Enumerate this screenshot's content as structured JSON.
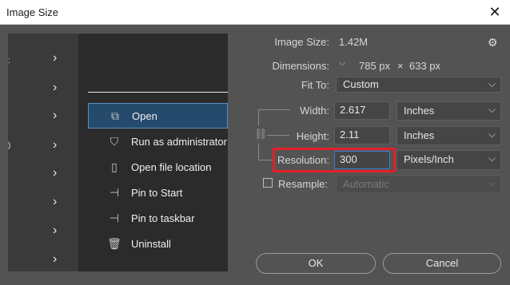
{
  "window": {
    "title": "Image Size"
  },
  "preview": {
    "menu_items": [
      {
        "label": "Open",
        "icon": "open-icon",
        "glyph": "⧉"
      },
      {
        "label": "Run as administrator",
        "icon": "shield-icon",
        "glyph": "⛉"
      },
      {
        "label": "Open file location",
        "icon": "file-location-icon",
        "glyph": "▯"
      },
      {
        "label": "Pin to Start",
        "icon": "pin-start-icon",
        "glyph": "⊣"
      },
      {
        "label": "Pin to taskbar",
        "icon": "pin-taskbar-icon",
        "glyph": "⊣"
      },
      {
        "label": "Uninstall",
        "icon": "trash-icon",
        "glyph": "🗑"
      }
    ]
  },
  "info": {
    "image_size_label": "Image Size:",
    "image_size_value": "1.42M",
    "dimensions_label": "Dimensions:",
    "dimensions_width": "785 px",
    "dimensions_times": "×",
    "dimensions_height": "633 px"
  },
  "fit_to": {
    "label": "Fit To:",
    "value": "Custom"
  },
  "width": {
    "label": "Width:",
    "value": "2.617",
    "unit": "Inches"
  },
  "height": {
    "label": "Height:",
    "value": "2.11",
    "unit": "Inches"
  },
  "resolution": {
    "label": "Resolution:",
    "value": "300",
    "unit": "Pixels/Inch"
  },
  "resample": {
    "label": "Resample:",
    "value": "Automatic",
    "checked": false
  },
  "buttons": {
    "ok": "OK",
    "cancel": "Cancel"
  },
  "colors": {
    "highlight": "#e4202a",
    "menu_active": "#264a6b"
  }
}
